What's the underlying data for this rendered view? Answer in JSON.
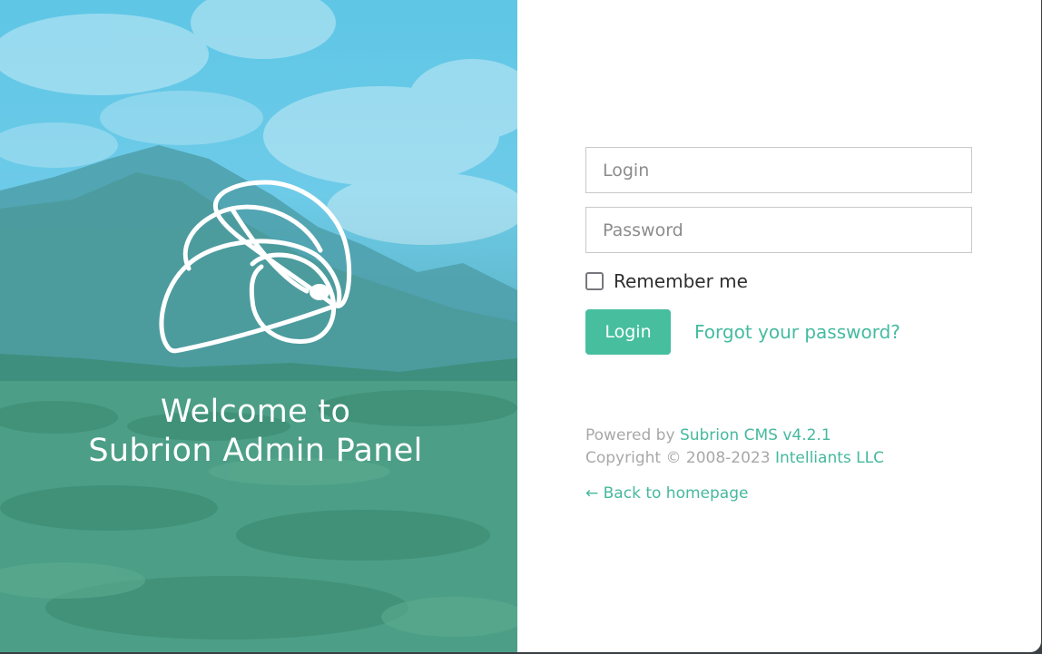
{
  "hero": {
    "title_line1": "Welcome to",
    "title_line2": "Subrion Admin Panel"
  },
  "login_form": {
    "login_placeholder": "Login",
    "password_placeholder": "Password",
    "login_value": "",
    "password_value": "",
    "remember_label": "Remember me",
    "remember_checked": false,
    "submit_label": "Login",
    "forgot_label": "Forgot your password?"
  },
  "footer": {
    "powered_prefix": "Powered by",
    "cms_link": "Subrion CMS v4.2.1",
    "copyright_prefix": "Copyright © 2008-2023",
    "company_link": "Intelliants LLC",
    "back_link": "← Back to homepage"
  },
  "icons": {
    "logo": "subrion-logo-icon",
    "checkbox": "checkbox-unchecked"
  },
  "colors": {
    "accent": "#47bf9f",
    "link": "#45b99e",
    "hero_overlay": "#5fc6e6"
  }
}
